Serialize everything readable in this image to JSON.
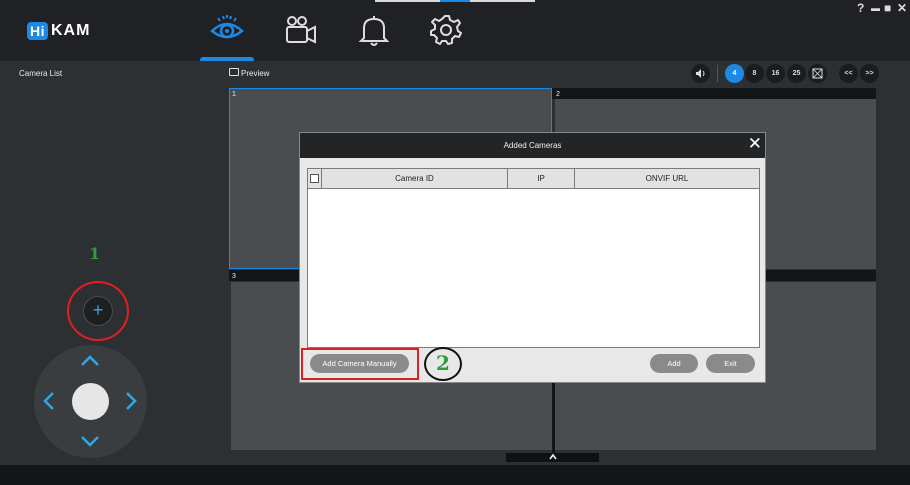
{
  "app": {
    "logo_hi": "Hi",
    "logo_kam": "KAM",
    "nav": [
      "preview-eye",
      "playback-camera",
      "alarm-bell",
      "settings-gear"
    ],
    "window_controls": {
      "help": "?",
      "minimize": "▬",
      "maximize": "■",
      "close": "✕"
    }
  },
  "left": {
    "camera_list_label": "Camera List",
    "add_button_label": "+",
    "annotation_1": "1"
  },
  "preview": {
    "label": "Preview",
    "layout_buttons": [
      "4",
      "8",
      "16",
      "25"
    ],
    "active_layout": "4",
    "prev_label": "<<",
    "next_label": ">>",
    "cells": [
      "1",
      "2",
      "3"
    ]
  },
  "dialog": {
    "title": "Added Cameras",
    "close": "✕",
    "columns": [
      "Camera ID",
      "IP",
      "ONVIF URL"
    ],
    "rows": [],
    "add_manually_label": "Add Camera Manually",
    "add_label": "Add",
    "exit_label": "Exit",
    "annotation_2": "2"
  },
  "colors": {
    "accent": "#1e88e5",
    "highlight_red": "#e02020",
    "annotation_green": "#2e9e3a"
  }
}
